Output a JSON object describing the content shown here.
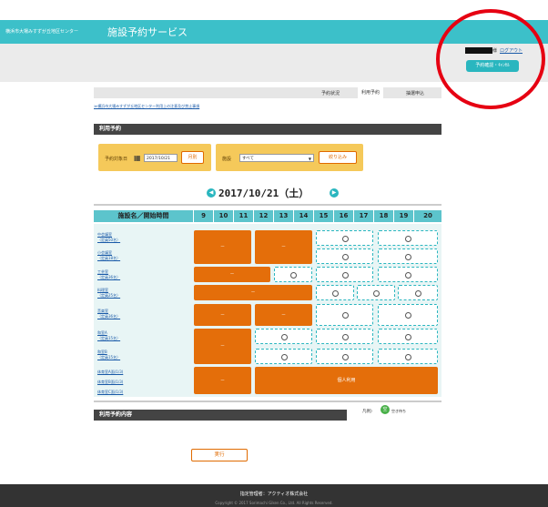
{
  "header": {
    "site_name": "横浜市大場みすずが丘地区センター",
    "service_name": "施設予約サービス"
  },
  "user": {
    "name_suffix": "様",
    "logout_label": "ログアウト",
    "confirm_button": "予約確認・ｷｬﾝｾﾙ"
  },
  "tabs": [
    "予約状況",
    "利用予約",
    "抽選申込"
  ],
  "active_tab": "利用予約",
  "notice_link": "≫横浜市大場みすずが丘地区センター利用上の注意及び禁止事項",
  "usage": {
    "section_title": "利用予約",
    "date_label": "予約対象日",
    "date_value": "2017/10/21",
    "monthly_button": "月別",
    "facility_label": "施設",
    "facility_value": "すべて",
    "filter_button": "絞り込み"
  },
  "date_nav": {
    "current_date": "2017/10/21（土）",
    "prev_icon": "arrow-left-icon",
    "next_icon": "arrow-right-icon"
  },
  "grid": {
    "header_label": "施設名／開始時間",
    "hours": [
      "9",
      "10",
      "11",
      "12",
      "13",
      "14",
      "15",
      "16",
      "17",
      "18",
      "19",
      "20"
    ],
    "facilities": [
      {
        "name": "中会議室",
        "capacity": "（定員50名）"
      },
      {
        "name": "小会議室",
        "capacity": "（定員18名）"
      },
      {
        "name": "工芸室",
        "capacity": "（定員36名）"
      },
      {
        "name": "料理室",
        "capacity": "（定員25名）"
      },
      {
        "name": "音楽室",
        "capacity": "（定員36名）"
      },
      {
        "name": "和室A",
        "capacity": "（定員15名）"
      },
      {
        "name": "和室B",
        "capacity": "（定員15名）"
      },
      {
        "name": "体育室A面(1/3)",
        "capacity": ""
      },
      {
        "name": "体育室B面(1/3)",
        "capacity": ""
      },
      {
        "name": "体育室C面(1/3)",
        "capacity": ""
      }
    ],
    "booked_symbol": "－",
    "personal_use_label": "個人利用"
  },
  "content_section": {
    "title": "利用予約内容",
    "legend_label": "凡例)",
    "legend_icon_text": "空",
    "legend_text": "空き待ち"
  },
  "execute_button": "実行",
  "footer": {
    "manager": "指定管理者：アクティオ株式会社",
    "copyright": "Copyright © 2017 Sorimachi Giken Co., Ltd. All Rights Reserved."
  },
  "colors": {
    "header": "#3cc0c9",
    "booked": "#e46e0a",
    "filter_bg": "#f5c95a",
    "annotation_circle": "#e60012"
  }
}
